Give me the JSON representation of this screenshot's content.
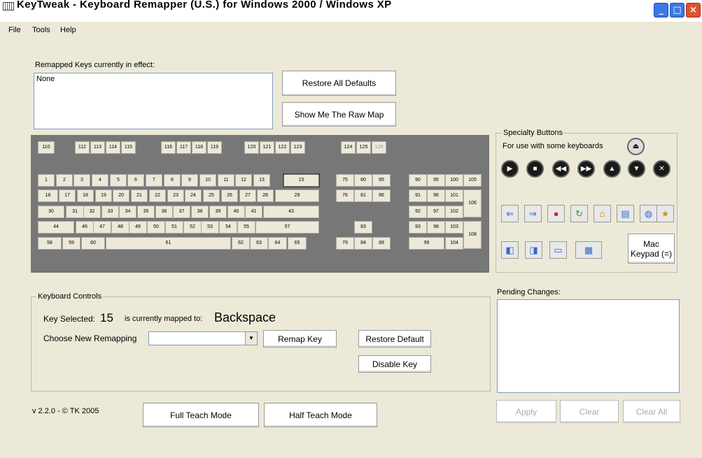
{
  "window": {
    "title": "KeyTweak -  Keyboard Remapper (U.S.)  for Windows 2000 / Windows XP"
  },
  "menu": {
    "file": "File",
    "tools": "Tools",
    "help": "Help"
  },
  "remapped": {
    "label": "Remapped Keys currently in effect:",
    "value": "None"
  },
  "buttons": {
    "restore_all": "Restore All Defaults",
    "raw_map": "Show Me The Raw Map",
    "remap": "Remap Key",
    "restore_default": "Restore Default",
    "disable": "Disable Key",
    "full_teach": "Full Teach Mode",
    "half_teach": "Half Teach Mode",
    "apply": "Apply",
    "clear": "Clear",
    "clear_all": "Clear All",
    "mac_keypad_line1": "Mac",
    "mac_keypad_line2": "Keypad (=)"
  },
  "specialty": {
    "title": "Specialty Buttons",
    "subtitle": "For use with some keyboards"
  },
  "controls": {
    "title": "Keyboard Controls",
    "key_selected_label": "Key Selected:",
    "key_selected": "15",
    "mapped_to_label": "is currently mapped to:",
    "mapped_to": "Backspace",
    "choose_label": "Choose New Remapping",
    "choose_value": ""
  },
  "pending": {
    "label": "Pending Changes:"
  },
  "version": "v 2.2.0 - © TK 2005",
  "keys": [
    {
      "label": "110"
    },
    {
      "label": "112"
    },
    {
      "label": "113"
    },
    {
      "label": "114"
    },
    {
      "label": "115"
    },
    {
      "label": "116"
    },
    {
      "label": "117"
    },
    {
      "label": "118"
    },
    {
      "label": "119"
    },
    {
      "label": "120"
    },
    {
      "label": "121"
    },
    {
      "label": "122"
    },
    {
      "label": "123"
    },
    {
      "label": "124"
    },
    {
      "label": "125"
    },
    {
      "label": "126"
    },
    {
      "label": "1"
    },
    {
      "label": "2"
    },
    {
      "label": "3"
    },
    {
      "label": "4"
    },
    {
      "label": "5"
    },
    {
      "label": "6"
    },
    {
      "label": "7"
    },
    {
      "label": "8"
    },
    {
      "label": "9"
    },
    {
      "label": "10"
    },
    {
      "label": "11"
    },
    {
      "label": "12"
    },
    {
      "label": "13"
    },
    {
      "label": "15"
    },
    {
      "label": "75"
    },
    {
      "label": "80"
    },
    {
      "label": "85"
    },
    {
      "label": "90"
    },
    {
      "label": "95"
    },
    {
      "label": "100"
    },
    {
      "label": "105"
    },
    {
      "label": "16"
    },
    {
      "label": "17"
    },
    {
      "label": "18"
    },
    {
      "label": "19"
    },
    {
      "label": "20"
    },
    {
      "label": "21"
    },
    {
      "label": "22"
    },
    {
      "label": "23"
    },
    {
      "label": "24"
    },
    {
      "label": "25"
    },
    {
      "label": "26"
    },
    {
      "label": "27"
    },
    {
      "label": "28"
    },
    {
      "label": "29"
    },
    {
      "label": "76"
    },
    {
      "label": "81"
    },
    {
      "label": "86"
    },
    {
      "label": "91"
    },
    {
      "label": "96"
    },
    {
      "label": "101"
    },
    {
      "label": "106"
    },
    {
      "label": "30"
    },
    {
      "label": "31"
    },
    {
      "label": "32"
    },
    {
      "label": "33"
    },
    {
      "label": "34"
    },
    {
      "label": "35"
    },
    {
      "label": "36"
    },
    {
      "label": "37"
    },
    {
      "label": "38"
    },
    {
      "label": "39"
    },
    {
      "label": "40"
    },
    {
      "label": "41"
    },
    {
      "label": "43"
    },
    {
      "label": "92"
    },
    {
      "label": "97"
    },
    {
      "label": "102"
    },
    {
      "label": "44"
    },
    {
      "label": "46"
    },
    {
      "label": "47"
    },
    {
      "label": "48"
    },
    {
      "label": "49"
    },
    {
      "label": "50"
    },
    {
      "label": "51"
    },
    {
      "label": "52"
    },
    {
      "label": "53"
    },
    {
      "label": "54"
    },
    {
      "label": "55"
    },
    {
      "label": "57"
    },
    {
      "label": "83"
    },
    {
      "label": "93"
    },
    {
      "label": "98"
    },
    {
      "label": "103"
    },
    {
      "label": "108"
    },
    {
      "label": "58"
    },
    {
      "label": "59"
    },
    {
      "label": "60"
    },
    {
      "label": "61"
    },
    {
      "label": "62"
    },
    {
      "label": "63"
    },
    {
      "label": "64"
    },
    {
      "label": "65"
    },
    {
      "label": "79"
    },
    {
      "label": "84"
    },
    {
      "label": "89"
    },
    {
      "label": "99"
    },
    {
      "label": "104"
    }
  ]
}
